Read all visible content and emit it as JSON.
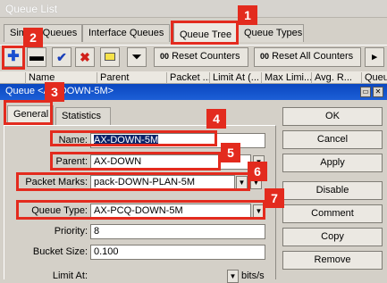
{
  "window_title": "Queue List",
  "tabs": [
    "Simple Queues",
    "Interface Queues",
    "Queue Tree",
    "Queue Types"
  ],
  "toolbar": {
    "add_icon": "plus-icon",
    "remove_icon": "minus-icon",
    "enable_icon": "check-icon",
    "disable_icon": "x-icon",
    "comment_icon": "note-icon",
    "filter_icon": "funnel-icon",
    "reset_counters": "Reset Counters",
    "reset_all_counters": "Reset All Counters",
    "reset_prefix": "00"
  },
  "columns": [
    "Name",
    "Parent",
    "Packet ...",
    "Limit At (...",
    "Max Limi...",
    "Avg. R...",
    "Queue..."
  ],
  "dialog": {
    "title": "Queue <AX-DOWN-5M>",
    "tabs": [
      "General",
      "Statistics"
    ],
    "fields": {
      "name_label": "Name:",
      "name_value": "AX-DOWN-5M",
      "parent_label": "Parent:",
      "parent_value": "AX-DOWN",
      "packet_marks_label": "Packet Marks:",
      "packet_marks_value": "pack-DOWN-PLAN-5M",
      "queue_type_label": "Queue Type:",
      "queue_type_value": "AX-PCQ-DOWN-5M",
      "priority_label": "Priority:",
      "priority_value": "8",
      "bucket_size_label": "Bucket Size:",
      "bucket_size_value": "0.100",
      "limit_at_label": "Limit At:",
      "limit_at_unit": "bits/s"
    },
    "buttons": [
      "OK",
      "Cancel",
      "Apply",
      "Disable",
      "Comment",
      "Copy",
      "Remove"
    ]
  },
  "badges": [
    "1",
    "2",
    "3",
    "4",
    "5",
    "6",
    "7"
  ],
  "colors": {
    "annotation": "#e32b1e",
    "title_blue": "#0a47c0"
  }
}
